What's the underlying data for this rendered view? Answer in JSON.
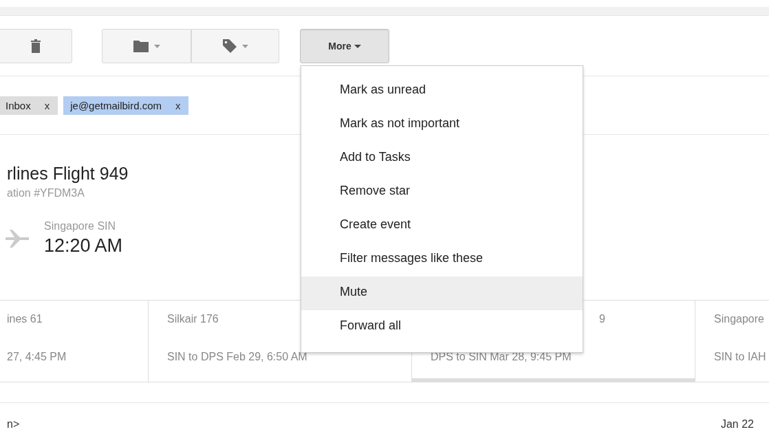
{
  "toolbar": {
    "buttons": [
      {
        "kind": "delete"
      },
      {
        "kind": "move",
        "caret": true
      },
      {
        "kind": "labels",
        "caret": true
      }
    ],
    "more": {
      "label": "More",
      "expanded": true
    }
  },
  "labels": [
    {
      "text": "Inbox",
      "remove": "x",
      "color": "#dddddd"
    },
    {
      "text": "je@getmailbird.com",
      "remove": "x",
      "color": "#b3cdf2"
    }
  ],
  "flight": {
    "title": "rlines Flight 949",
    "confirmation": "ation #YFDM3A",
    "origin": "Singapore SIN",
    "time": "12:20 AM"
  },
  "legs": [
    {
      "title": "ines 61",
      "detail": "27, 4:45 PM",
      "selected": false,
      "covered": false
    },
    {
      "title": "Silkair 176",
      "detail": "SIN to DPS Feb 29, 6:50 AM",
      "selected": false,
      "covered": false
    },
    {
      "title": "9",
      "detail": "DPS to SIN Mar 28, 9:45 PM",
      "selected": true,
      "covered": true
    },
    {
      "title": "Singapore",
      "detail": "SIN to IAH",
      "selected": false,
      "covered": false
    }
  ],
  "message": {
    "sender": "n>",
    "date": "Jan 22"
  },
  "menu": [
    {
      "label": "Mark as unread",
      "selected": false
    },
    {
      "label": "Mark as not important",
      "selected": false
    },
    {
      "label": "Add to Tasks",
      "selected": false
    },
    {
      "label": "Remove star",
      "selected": false
    },
    {
      "label": "Create event",
      "selected": false
    },
    {
      "label": "Filter messages like these",
      "selected": false
    },
    {
      "label": "Mute",
      "selected": true
    },
    {
      "label": "Forward all",
      "selected": false
    }
  ]
}
